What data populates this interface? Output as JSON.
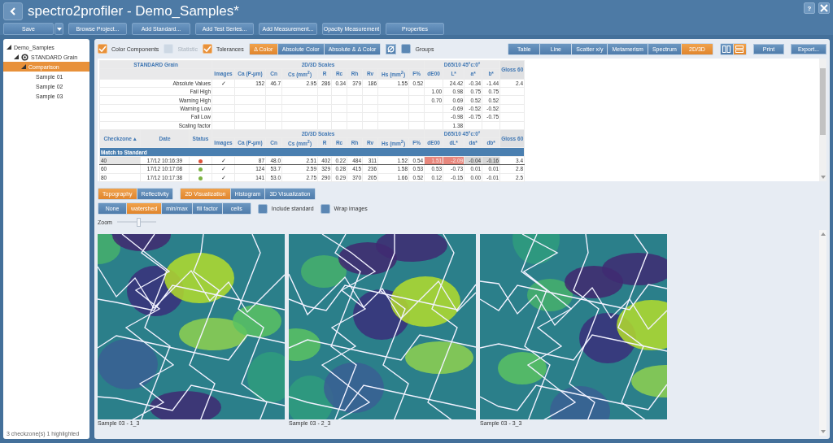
{
  "window": {
    "title": "spectro2profiler - Demo_Samples*",
    "help": "?"
  },
  "toolbar": {
    "save": "Save",
    "buttons": [
      "Browse Project...",
      "Add Standard...",
      "Add Test Series...",
      "Add Measurement...",
      "Opacity Measurement",
      "Properties"
    ]
  },
  "sidebar": {
    "tree": [
      {
        "label": "Demo_Samples",
        "expanded": true,
        "selected": false,
        "children": [
          {
            "label": "STANDARD Grain",
            "kind": "standard",
            "expanded": true,
            "selected": false,
            "children": [
              {
                "label": "Comparison",
                "expanded": true,
                "selected": true,
                "children": [
                  {
                    "label": "Sample 01",
                    "selected": false
                  },
                  {
                    "label": "Sample 02",
                    "selected": false
                  },
                  {
                    "label": "Sample 03",
                    "selected": false
                  }
                ]
              }
            ]
          }
        ]
      }
    ],
    "footer": "3 checkzone(s) 1 highlighted"
  },
  "options": {
    "checks": [
      {
        "label": "Color Components",
        "checked": true,
        "disabled": false
      },
      {
        "label": "Statistic",
        "checked": false,
        "disabled": true
      },
      {
        "label": "Tolerances",
        "checked": true,
        "disabled": false
      }
    ],
    "color_modes": [
      {
        "label": "Δ Color",
        "selected": true
      },
      {
        "label": "Absolute Color",
        "selected": false
      },
      {
        "label": "Absolute & Δ Color",
        "selected": false
      }
    ],
    "groups": {
      "label": "Groups",
      "checked": false
    },
    "views": [
      {
        "label": "Table",
        "selected": false
      },
      {
        "label": "Line",
        "selected": false
      },
      {
        "label": "Scatter x/y",
        "selected": false
      },
      {
        "label": "Metamerism",
        "selected": false
      },
      {
        "label": "Spectrum",
        "selected": false
      },
      {
        "label": "2D/3D",
        "selected": true
      }
    ],
    "layouts": [
      {
        "kind": "columns",
        "selected": false
      },
      {
        "kind": "rows",
        "selected": true
      }
    ],
    "actions": [
      "Print",
      "Export..."
    ]
  },
  "table": {
    "standard": {
      "title": "STANDARD Grain",
      "gloss_header": "Gloss 60",
      "groups": [
        {
          "label": "2D/3D Scales",
          "columns": [
            "Images",
            "Ca (P-µm)",
            "Cn",
            "Cs (mm$^{2}$)",
            "R",
            "Rc",
            "Rh",
            "Rv",
            "Hs (mm$^{2}$)",
            "F%"
          ]
        },
        {
          "label": "D65/10  45°c:0°",
          "columns": [
            "dE00",
            "L*",
            "a*",
            "b*"
          ]
        }
      ],
      "rows": [
        {
          "label": "Absolute Values",
          "cells": [
            "✓",
            "152",
            "46.7",
            "2.95",
            "286",
            "0.34",
            "379",
            "186",
            "1.55",
            "0.52",
            null,
            "24.42",
            "-0.34",
            "-1.44",
            "2.4"
          ]
        },
        {
          "label": "Fail High",
          "cells": [
            null,
            null,
            null,
            null,
            null,
            null,
            null,
            null,
            null,
            null,
            "1.00",
            "0.98",
            "0.75",
            "0.75",
            null
          ]
        },
        {
          "label": "Warning High",
          "cells": [
            null,
            null,
            null,
            null,
            null,
            null,
            null,
            null,
            null,
            null,
            "0.70",
            "0.69",
            "0.52",
            "0.52",
            null
          ]
        },
        {
          "label": "Warning Low",
          "cells": [
            null,
            null,
            null,
            null,
            null,
            null,
            null,
            null,
            null,
            null,
            null,
            "-0.69",
            "-0.52",
            "-0.52",
            null
          ]
        },
        {
          "label": "Fail Low",
          "cells": [
            null,
            null,
            null,
            null,
            null,
            null,
            null,
            null,
            null,
            null,
            null,
            "-0.98",
            "-0.75",
            "-0.75",
            null
          ]
        },
        {
          "label": "Scaling factor",
          "cells": [
            null,
            null,
            null,
            null,
            null,
            null,
            null,
            null,
            null,
            null,
            null,
            "1.38",
            null,
            null,
            null
          ]
        }
      ]
    },
    "results": {
      "columns": [
        "Checkzone ▴",
        "Date",
        "Status"
      ],
      "gloss_header": "Gloss 60",
      "group_title": "Match to Standard",
      "groups": [
        {
          "label": "2D/3D Scales",
          "columns": [
            "Images",
            "Ca (P-µm)",
            "Cn",
            "Cs (mm$^{2}$)",
            "R",
            "Rc",
            "Rh",
            "Rv",
            "Hs (mm$^{2}$)",
            "F%"
          ]
        },
        {
          "label": "D65/10  45°c:0°",
          "columns": [
            "dE00",
            "dL*",
            "da*",
            "db*"
          ]
        }
      ],
      "rows": [
        {
          "checkzone": "40",
          "date": "17/12 10:16:39",
          "color": "#e0533a",
          "selected": true,
          "cells": [
            "✓",
            "87",
            "48.0",
            "2.51",
            "402",
            "0.22",
            "484",
            "311",
            "1.52",
            "0.54",
            {
              "text": "1.51",
              "fail": true
            },
            {
              "text": "-2.09",
              "fail": true
            },
            {
              "text": "-0.04",
              "warning": true
            },
            {
              "text": "-0.16",
              "warning": true
            },
            "3.4"
          ]
        },
        {
          "checkzone": "60",
          "date": "17/12 10:17:08",
          "color": "#7cb342",
          "selected": false,
          "cells": [
            "✓",
            "124",
            "53.7",
            "2.59",
            "329",
            "0.28",
            "415",
            "236",
            "1.58",
            "0.53",
            "0.53",
            "-0.73",
            "0.01",
            "0.01",
            "2.8"
          ]
        },
        {
          "checkzone": "80",
          "date": "17/12 10:17:38",
          "color": "#7cb342",
          "selected": false,
          "cells": [
            "✓",
            "141",
            "53.0",
            "2.75",
            "290",
            "0.29",
            "370",
            "205",
            "1.66",
            "0.52",
            "0.12",
            "-0.15",
            "0.00",
            "-0.01",
            "2.5"
          ]
        }
      ]
    }
  },
  "visualization": {
    "sources": [
      {
        "label": "Topography",
        "selected": true
      },
      {
        "label": "Reflectivity",
        "selected": false
      }
    ],
    "modes": [
      {
        "label": "2D Visualization",
        "selected": true
      },
      {
        "label": "Histogram",
        "selected": false
      },
      {
        "label": "3D Visualization",
        "selected": false
      }
    ],
    "overlays": [
      {
        "label": "None",
        "selected": false
      },
      {
        "label": "watershed",
        "selected": true
      },
      {
        "label": "min/max",
        "selected": false
      },
      {
        "label": "fill factor",
        "selected": false
      },
      {
        "label": "cells",
        "selected": false
      }
    ],
    "checks": [
      {
        "label": "Include standard",
        "checked": false
      },
      {
        "label": "Wrap images",
        "checked": false
      }
    ],
    "zoom": {
      "label": "Zoom",
      "level": 0.55
    },
    "images": [
      {
        "kind": "picture",
        "caption": "Sample 03 - 1_3"
      },
      {
        "kind": "picture",
        "caption": "Sample 03 - 2_3"
      },
      {
        "kind": "picture",
        "caption": "Sample 03 - 3_3"
      }
    ]
  }
}
